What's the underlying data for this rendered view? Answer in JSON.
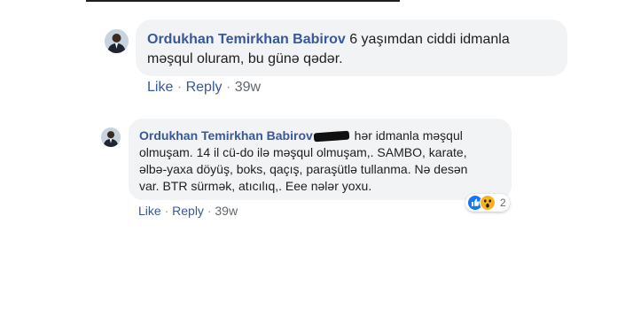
{
  "comments": [
    {
      "author": "Ordukhan Temirkhan Babirov",
      "text_lines": [
        "6 yaşımdan ciddi idmanla",
        "məşqul oluram, bu günə qədər."
      ],
      "like_label": "Like",
      "reply_label": "Reply",
      "time": "39w"
    },
    {
      "author": "Ordukhan Temirkhan Babirov",
      "text_lines": [
        "hər idmanla məşqul",
        "olmuşam. 14 il cü-do ilə məşqul olmuşam,. SAMBO, karate,",
        "əlbə-yaxa döyüş, boks, qaçış, paraşütlə tullanma. Nə desən",
        "var. BTR sürmək, atıcılıq,. Eee nələr yoxu."
      ],
      "like_label": "Like",
      "reply_label": "Reply",
      "time": "39w",
      "reactions": {
        "icons": [
          "like-icon",
          "wow-icon"
        ],
        "count": "2"
      }
    }
  ],
  "separator": "·",
  "colors": {
    "link": "#385898",
    "bubble": "#f2f3f5",
    "like": "#1877f2",
    "wow": "#f7b125"
  }
}
